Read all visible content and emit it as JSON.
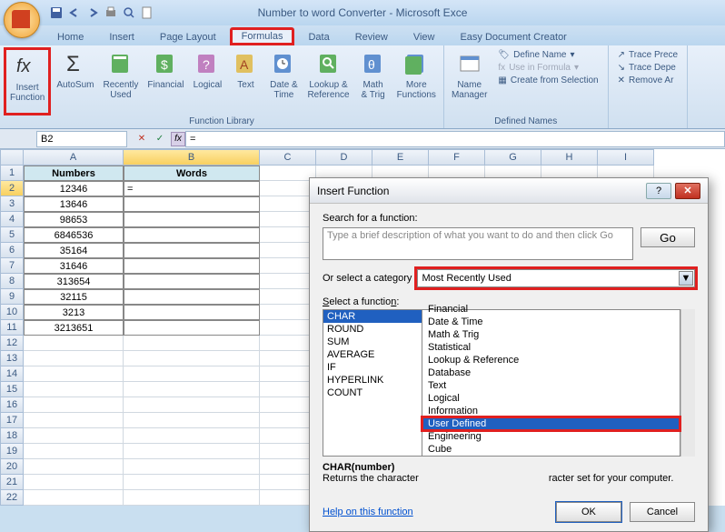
{
  "app": {
    "title": "Number to word Converter - Microsoft Exce"
  },
  "tabs": {
    "home": "Home",
    "insert": "Insert",
    "page_layout": "Page Layout",
    "formulas": "Formulas",
    "data": "Data",
    "review": "Review",
    "view": "View",
    "easy": "Easy Document Creator"
  },
  "ribbon": {
    "insert_function": "Insert\nFunction",
    "autosum": "AutoSum",
    "recently_used": "Recently\nUsed",
    "financial": "Financial",
    "logical": "Logical",
    "text": "Text",
    "date_time": "Date &\nTime",
    "lookup": "Lookup &\nReference",
    "math": "Math\n& Trig",
    "more": "More\nFunctions",
    "name_manager": "Name\nManager",
    "define_name": "Define Name",
    "use_in_formula": "Use in Formula",
    "create_selection": "Create from Selection",
    "trace_prec": "Trace Prece",
    "trace_dep": "Trace Depe",
    "remove_ar": "Remove Ar",
    "group_library": "Function Library",
    "group_names": "Defined Names"
  },
  "formula_bar": {
    "name_box": "B2",
    "formula": "="
  },
  "columns": {
    "a": "A",
    "b": "B",
    "c": "C",
    "d": "D",
    "e": "E",
    "f": "F",
    "g": "G",
    "h": "H",
    "i": "I"
  },
  "headers": {
    "numbers": "Numbers",
    "words": "Words"
  },
  "data_rows": {
    "r2": {
      "a": "12346",
      "b": "="
    },
    "r3": {
      "a": "13646"
    },
    "r4": {
      "a": "98653"
    },
    "r5": {
      "a": "6846536"
    },
    "r6": {
      "a": "35164"
    },
    "r7": {
      "a": "31646"
    },
    "r8": {
      "a": "313654"
    },
    "r9": {
      "a": "32115"
    },
    "r10": {
      "a": "3213"
    },
    "r11": {
      "a": "3213651"
    }
  },
  "dialog": {
    "title": "Insert Function",
    "search_label": "Search for a function:",
    "search_placeholder": "Type a brief description of what you want to do and then click Go",
    "go": "Go",
    "category_label": "Or select a category",
    "category_value": "Most Recently Used",
    "select_label": "Select a function:",
    "functions": {
      "char": "CHAR",
      "round": "ROUND",
      "sum": "SUM",
      "average": "AVERAGE",
      "if": "IF",
      "hyperlink": "HYPERLINK",
      "count": "COUNT"
    },
    "categories": {
      "financial": "Financial",
      "date_time": "Date & Time",
      "math": "Math & Trig",
      "statistical": "Statistical",
      "lookup": "Lookup & Reference",
      "database": "Database",
      "text": "Text",
      "logical": "Logical",
      "information": "Information",
      "user_defined": "User Defined",
      "engineering": "Engineering",
      "cube": "Cube"
    },
    "syntax": "CHAR(number)",
    "desc": "Returns the character",
    "desc_tail": "racter set for your computer.",
    "help": "Help on this function",
    "ok": "OK",
    "cancel": "Cancel"
  }
}
